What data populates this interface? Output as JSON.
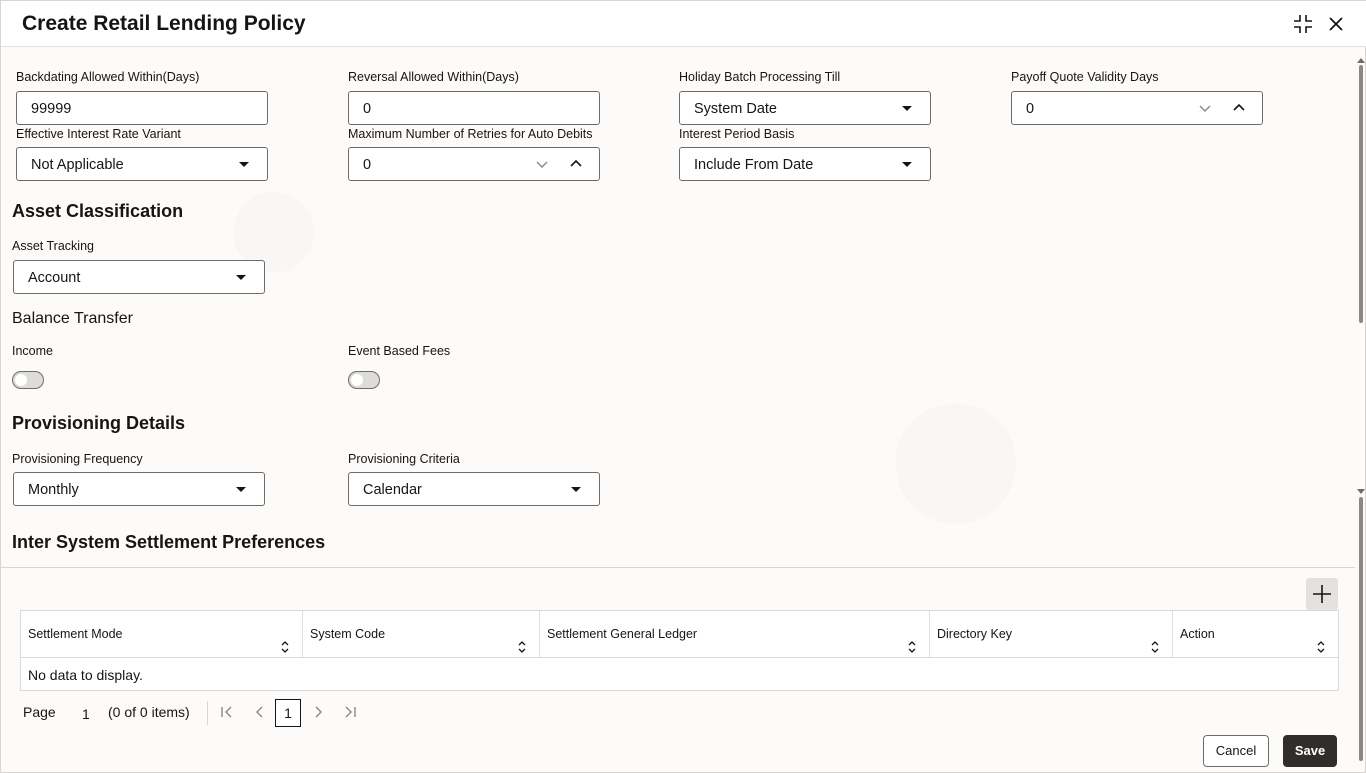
{
  "dialog": {
    "title": "Create Retail Lending Policy"
  },
  "fields": {
    "backdating": {
      "label": "Backdating Allowed Within(Days)",
      "value": "99999"
    },
    "reversal": {
      "label": "Reversal Allowed Within(Days)",
      "value": "0"
    },
    "holiday_batch": {
      "label": "Holiday Batch Processing Till",
      "value": "System Date"
    },
    "payoff_quote": {
      "label": "Payoff Quote Validity Days",
      "value": "0"
    },
    "eir_variant": {
      "label": "Effective Interest Rate Variant",
      "value": "Not Applicable"
    },
    "max_retries": {
      "label": "Maximum Number of Retries for Auto Debits",
      "value": "0"
    },
    "interest_period": {
      "label": "Interest Period Basis",
      "value": "Include From Date"
    }
  },
  "asset_classification": {
    "heading": "Asset Classification",
    "asset_tracking": {
      "label": "Asset Tracking",
      "value": "Account"
    }
  },
  "balance_transfer": {
    "heading": "Balance Transfer",
    "income_label": "Income",
    "income_on": false,
    "event_fees_label": "Event Based Fees",
    "event_fees_on": false
  },
  "provisioning": {
    "heading": "Provisioning Details",
    "frequency": {
      "label": "Provisioning Frequency",
      "value": "Monthly"
    },
    "criteria": {
      "label": "Provisioning Criteria",
      "value": "Calendar"
    }
  },
  "settlement": {
    "heading": "Inter System Settlement Preferences",
    "columns": [
      "Settlement Mode",
      "System Code",
      "Settlement General Ledger",
      "Directory Key",
      "Action"
    ],
    "empty_text": "No data to display."
  },
  "pager": {
    "page_label": "Page",
    "page_value": "1",
    "items_text": "(0 of 0 items)",
    "current": "1"
  },
  "footer": {
    "cancel": "Cancel",
    "save": "Save"
  }
}
